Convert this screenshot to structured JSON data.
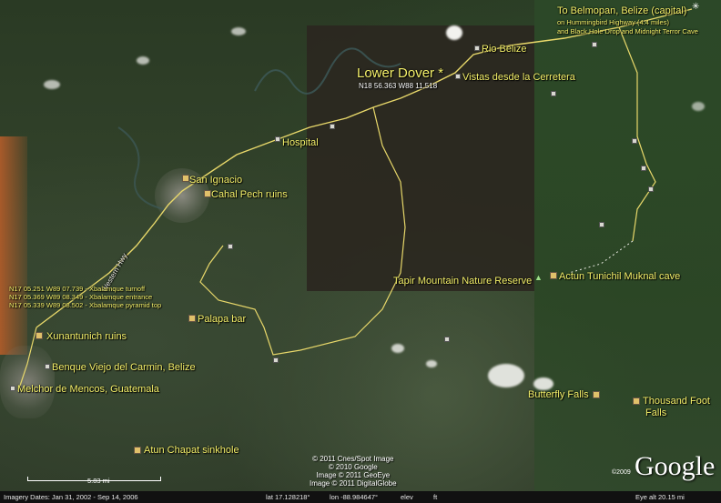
{
  "map": {
    "labels": {
      "lower_dover": "Lower Dover *",
      "lower_dover_coords": "N18 56.363 W88 11.518",
      "belmopan": "To Belmopan, Belize (capital)",
      "belmopan_sub1": "on Hummingbird Highway (4.4 miles)",
      "belmopan_sub2": "and Black Hole Drop and Midnight Terror Cave",
      "rio_belize": "Rio Belize",
      "vistas": "Vistas desde la Cerretera",
      "hospital": "Hospital",
      "san_ignacio": "San Ignacio",
      "cahal_pech": "Cahal Pech ruins",
      "western_hwy": "Western Hwy",
      "xbal1": "N17 05.251 W89 07.739 - Xbalamque turnoff",
      "xbal2": "N17 05.369 W89 08.349 - Xbalamque entrance",
      "xbal3": "N17 05.339 W89 08.502 - Xbalamque pyramid top",
      "palapa_bar": "Palapa bar",
      "xunantunich": "Xunantunich ruins",
      "benque": "Benque Viejo del Carmin, Belize",
      "melchor": "Melchor de Mencos, Guatemala",
      "atun_chapat": "Atun Chapat sinkhole",
      "tapir": "Tapir Mountain Nature Reserve",
      "atm": "Actun Tunichil Muknal cave",
      "butterfly": "Butterfly Falls",
      "thousand1": "Thousand Foot",
      "thousand2": "Falls"
    },
    "credits": {
      "line1": "© 2011 Cnes/Spot Image",
      "line2": "© 2010 Google",
      "line3": "Image © 2011 GeoEye",
      "line4": "Image © 2011 DigitalGlobe"
    },
    "logo": "Google",
    "copyright_year": "©2009",
    "scale": "5.83 mi"
  },
  "status": {
    "imagery_dates": "Imagery Dates: Jan 31, 2002 - Sep 14, 2006",
    "lat": "lat  17.128218°",
    "lon": "lon  -88.984647°",
    "elev": "elev",
    "ft": "ft",
    "eye_alt": "Eye alt   20.15 mi"
  },
  "colors": {
    "label": "#f4f06a",
    "road": "#e8d86a",
    "statusbar": "#111111"
  }
}
